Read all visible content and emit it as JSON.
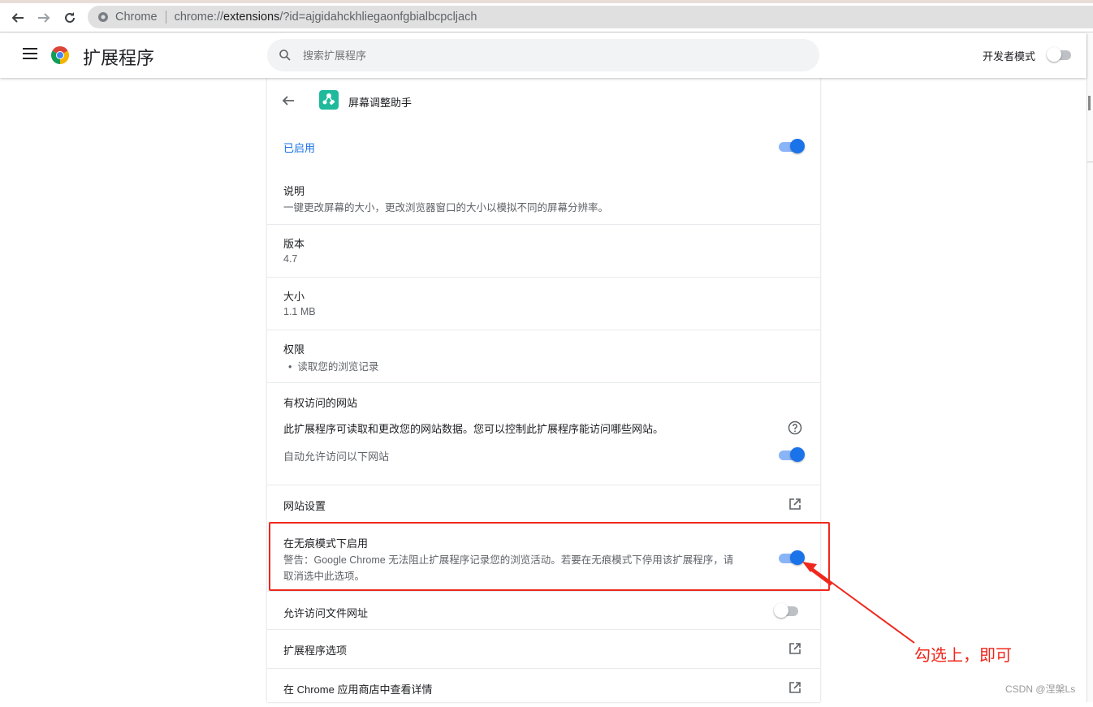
{
  "browser": {
    "omnibox_site": "Chrome",
    "url_prefix": "chrome://",
    "url_host": "extensions",
    "url_rest": "/?id=ajgidahckhliegaonfgbialbcpcljach"
  },
  "header": {
    "title": "扩展程序",
    "search_placeholder": "搜索扩展程序",
    "dev_mode_label": "开发者模式",
    "dev_mode_on": false
  },
  "extension": {
    "name": "屏幕调整助手",
    "icon_color": "#1fba9c",
    "enabled_label": "已启用",
    "enabled": true,
    "description_label": "说明",
    "description": "一键更改屏幕的大小，更改浏览器窗口的大小以模拟不同的屏幕分辨率。",
    "version_label": "版本",
    "version": "4.7",
    "size_label": "大小",
    "size": "1.1 MB",
    "permissions_label": "权限",
    "permissions": [
      "读取您的浏览记录"
    ],
    "site_access_label": "有权访问的网站",
    "site_access_desc": "此扩展程序可读取和更改您的网站数据。您可以控制此扩展程序能访问哪些网站。",
    "auto_allow_label": "自动允许访问以下网站",
    "auto_allow": true,
    "site_settings_label": "网站设置",
    "incognito_label": "在无痕模式下启用",
    "incognito_warning": "警告：Google Chrome 无法阻止扩展程序记录您的浏览活动。若要在无痕模式下停用该扩展程序，请",
    "incognito_warning_2": "取消选中此选项。",
    "incognito": true,
    "file_urls_label": "允许访问文件网址",
    "file_urls": false,
    "options_label": "扩展程序选项",
    "webstore_label": "在 Chrome 应用商店中查看详情"
  },
  "annotation": {
    "text": "勾选上，即可",
    "color": "#f0271c"
  },
  "watermark": "CSDN @涅槃Ls"
}
